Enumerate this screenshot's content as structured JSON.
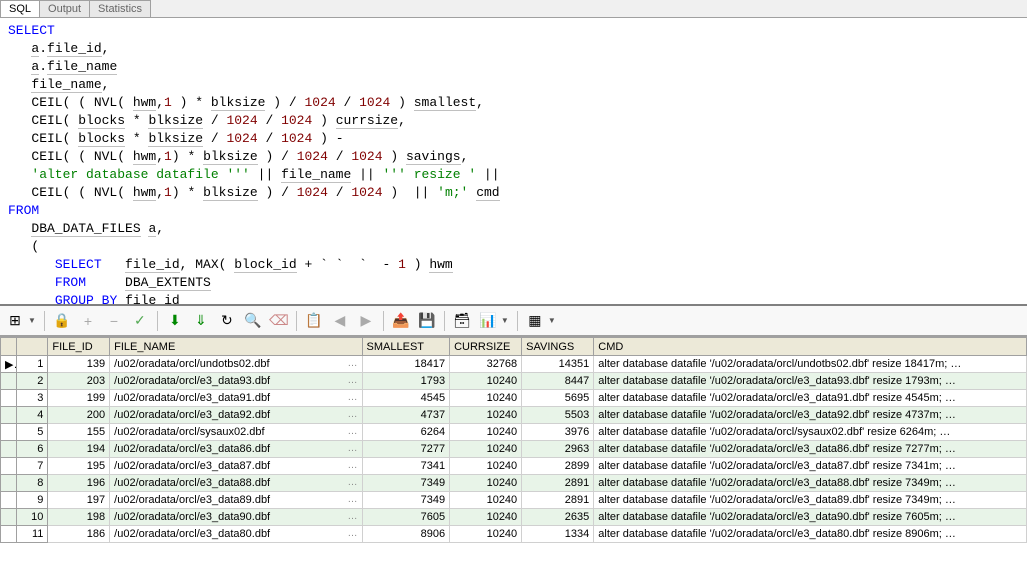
{
  "tabs": [
    {
      "label": "SQL",
      "active": true
    },
    {
      "label": "Output",
      "active": false
    },
    {
      "label": "Statistics",
      "active": false
    }
  ],
  "sql": {
    "line1_kw": "SELECT",
    "line2": "   a.file_id,",
    "line3": "   a.file_name",
    "line4": "   file_name,",
    "line5_pre": "   CEIL( ( NVL( hwm,1 ) * blksize ) / 1024 / 1024 ) smallest,",
    "line6": "   CEIL( blocks * blksize / 1024 / 1024 ) currsize,",
    "line7": "   CEIL( blocks * blksize / 1024 / 1024 ) -",
    "line8": "   CEIL( ( NVL( hwm,1) * blksize ) / 1024 / 1024 ) savings,",
    "line9": "   'alter database datafile ''' || file_name || ''' resize ' ||",
    "line10": "   CEIL( ( NVL( hwm,1) * blksize ) / 1024 / 1024 )  || 'm;' cmd",
    "line11_kw": "FROM",
    "line12": "   DBA_DATA_FILES a,",
    "line13": "   (",
    "line14": "      SELECT   file_id, MAX( block_id + ` `  `  - 1 ) hwm",
    "line15": "      FROM     DBA_EXTENTS",
    "line16": "      GROUP BY file_id"
  },
  "toolbar_icons": {
    "grid": "⊞",
    "lock": "🔒",
    "plus": "+",
    "minus": "−",
    "check": "✓",
    "down1": "⬇",
    "down2": "⇓",
    "refresh": "↻",
    "find": "🔍",
    "eraser": "⌫",
    "copy": "📋",
    "left": "◀",
    "right": "▶",
    "export": "📤",
    "save": "💾",
    "db": "🗃",
    "chart": "📊",
    "columns": "▦"
  },
  "columns": [
    "",
    "",
    "FILE_ID",
    "FILE_NAME",
    "SMALLEST",
    "CURRSIZE",
    "SAVINGS",
    "CMD"
  ],
  "rows": [
    {
      "n": 1,
      "sel": "▶",
      "file_id": 139,
      "file_name": "/u02/oradata/orcl/undotbs02.dbf",
      "smallest": 18417,
      "currsize": 32768,
      "savings": 14351,
      "cmd": "alter database datafile '/u02/oradata/orcl/undotbs02.dbf' resize 18417m; …"
    },
    {
      "n": 2,
      "sel": "",
      "file_id": 203,
      "file_name": "/u02/oradata/orcl/e3_data93.dbf",
      "smallest": 1793,
      "currsize": 10240,
      "savings": 8447,
      "cmd": "alter database datafile '/u02/oradata/orcl/e3_data93.dbf' resize 1793m; …"
    },
    {
      "n": 3,
      "sel": "",
      "file_id": 199,
      "file_name": "/u02/oradata/orcl/e3_data91.dbf",
      "smallest": 4545,
      "currsize": 10240,
      "savings": 5695,
      "cmd": "alter database datafile '/u02/oradata/orcl/e3_data91.dbf' resize 4545m; …"
    },
    {
      "n": 4,
      "sel": "",
      "file_id": 200,
      "file_name": "/u02/oradata/orcl/e3_data92.dbf",
      "smallest": 4737,
      "currsize": 10240,
      "savings": 5503,
      "cmd": "alter database datafile '/u02/oradata/orcl/e3_data92.dbf' resize 4737m; …"
    },
    {
      "n": 5,
      "sel": "",
      "file_id": 155,
      "file_name": "/u02/oradata/orcl/sysaux02.dbf",
      "smallest": 6264,
      "currsize": 10240,
      "savings": 3976,
      "cmd": "alter database datafile '/u02/oradata/orcl/sysaux02.dbf' resize 6264m; …"
    },
    {
      "n": 6,
      "sel": "",
      "file_id": 194,
      "file_name": "/u02/oradata/orcl/e3_data86.dbf",
      "smallest": 7277,
      "currsize": 10240,
      "savings": 2963,
      "cmd": "alter database datafile '/u02/oradata/orcl/e3_data86.dbf' resize 7277m; …"
    },
    {
      "n": 7,
      "sel": "",
      "file_id": 195,
      "file_name": "/u02/oradata/orcl/e3_data87.dbf",
      "smallest": 7341,
      "currsize": 10240,
      "savings": 2899,
      "cmd": "alter database datafile '/u02/oradata/orcl/e3_data87.dbf' resize 7341m; …"
    },
    {
      "n": 8,
      "sel": "",
      "file_id": 196,
      "file_name": "/u02/oradata/orcl/e3_data88.dbf",
      "smallest": 7349,
      "currsize": 10240,
      "savings": 2891,
      "cmd": "alter database datafile '/u02/oradata/orcl/e3_data88.dbf' resize 7349m; …"
    },
    {
      "n": 9,
      "sel": "",
      "file_id": 197,
      "file_name": "/u02/oradata/orcl/e3_data89.dbf",
      "smallest": 7349,
      "currsize": 10240,
      "savings": 2891,
      "cmd": "alter database datafile '/u02/oradata/orcl/e3_data89.dbf' resize 7349m; …"
    },
    {
      "n": 10,
      "sel": "",
      "file_id": 198,
      "file_name": "/u02/oradata/orcl/e3_data90.dbf",
      "smallest": 7605,
      "currsize": 10240,
      "savings": 2635,
      "cmd": "alter database datafile '/u02/oradata/orcl/e3_data90.dbf' resize 7605m; …"
    },
    {
      "n": 11,
      "sel": "",
      "file_id": 186,
      "file_name": "/u02/oradata/orcl/e3_data80.dbf",
      "smallest": 8906,
      "currsize": 10240,
      "savings": 1334,
      "cmd": "alter database datafile '/u02/oradata/orcl/e3_data80.dbf' resize 8906m; …"
    }
  ]
}
